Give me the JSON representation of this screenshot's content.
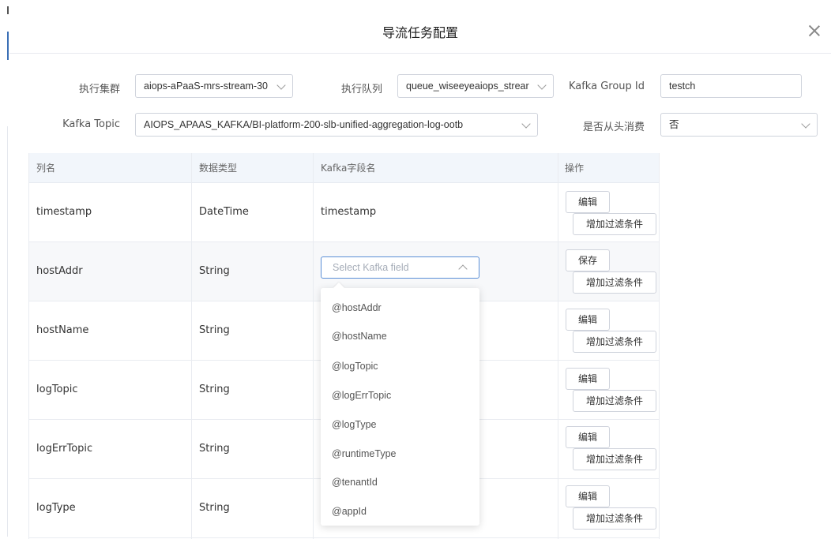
{
  "dialog": {
    "title": "导流任务配置"
  },
  "form": {
    "cluster_label": "执行集群",
    "cluster_value": "aiops-aPaaS-mrs-stream-30",
    "queue_label": "执行队列",
    "queue_value": "queue_wiseeyeaiops_strear",
    "group_label": "Kafka Group Id",
    "group_value": "testch",
    "topic_label": "Kafka Topic",
    "topic_value": "AIOPS_APAAS_KAFKA/BI-platform-200-slb-unified-aggregation-log-ootb",
    "from_start_label": "是否从头消费",
    "from_start_value": "否"
  },
  "table": {
    "headers": [
      "列名",
      "数据类型",
      "Kafka字段名",
      "操作"
    ],
    "rows": [
      {
        "name": "timestamp",
        "type": "DateTime",
        "kafka": "timestamp",
        "action1": "编辑",
        "action2": "增加过滤条件"
      },
      {
        "name": "hostAddr",
        "type": "String",
        "kafka": "",
        "action1": "保存",
        "action2": "增加过滤条件"
      },
      {
        "name": "hostName",
        "type": "String",
        "kafka": "",
        "action1": "编辑",
        "action2": "增加过滤条件"
      },
      {
        "name": "logTopic",
        "type": "String",
        "kafka": "",
        "action1": "编辑",
        "action2": "增加过滤条件"
      },
      {
        "name": "logErrTopic",
        "type": "String",
        "kafka": "",
        "action1": "编辑",
        "action2": "增加过滤条件"
      },
      {
        "name": "logType",
        "type": "String",
        "kafka": "",
        "action1": "编辑",
        "action2": "增加过滤条件"
      }
    ]
  },
  "kafka_select": {
    "placeholder": "Select Kafka field",
    "options": [
      "@hostAddr",
      "@hostName",
      "@logTopic",
      "@logErrTopic",
      "@logType",
      "@runtimeType",
      "@tenantId",
      "@appId"
    ]
  }
}
